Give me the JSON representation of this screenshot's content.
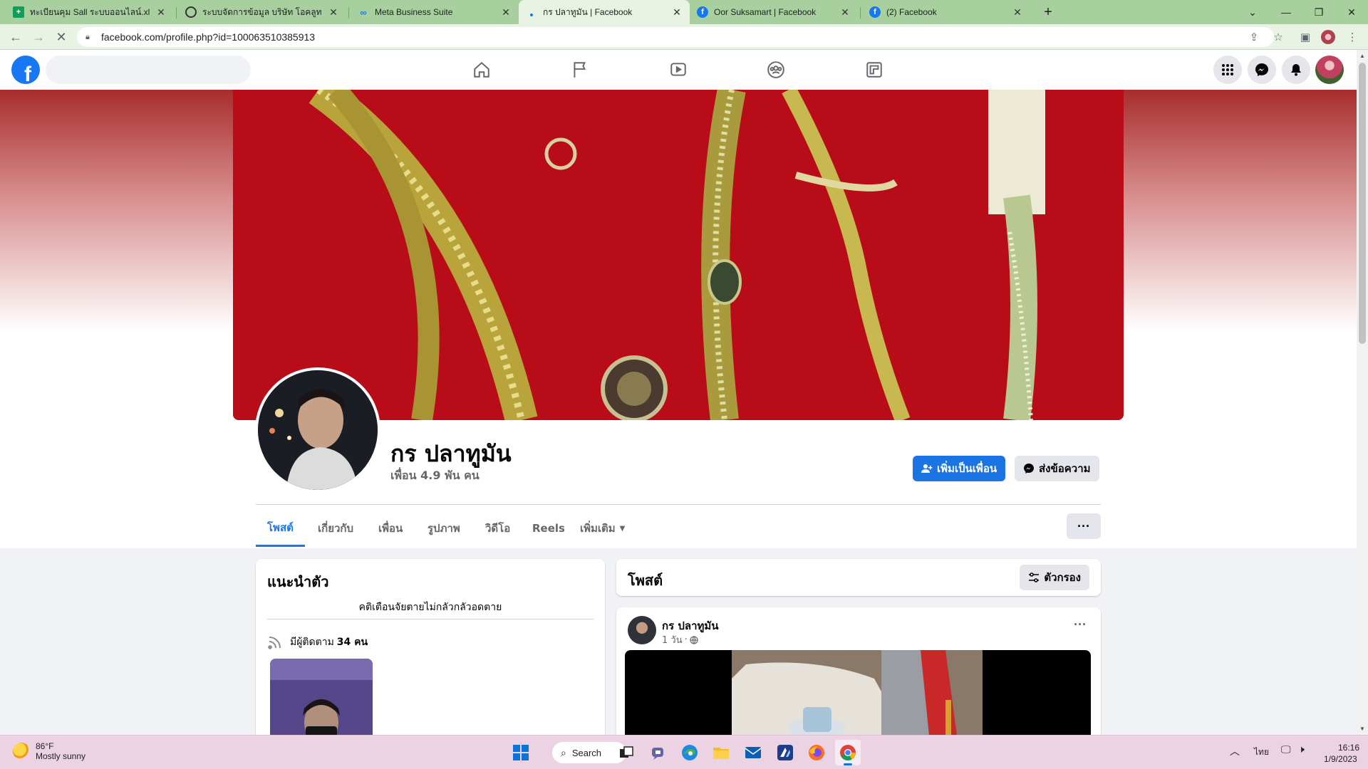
{
  "browser": {
    "tabs": [
      {
        "title": "ทะเบียนคุม Sall ระบบออนไลน์.xlsx - Goo",
        "icon": "google-sheets-icon"
      },
      {
        "title": "ระบบจัดการข้อมูล บริษัท โอคลูทเน็ต จำ",
        "icon": "globe-icon"
      },
      {
        "title": "Meta Business Suite",
        "icon": "meta-icon"
      },
      {
        "title": "กร ปลาทูมัน | Facebook",
        "icon": "loading-icon"
      },
      {
        "title": "Oor Suksamart | Facebook",
        "icon": "facebook-icon"
      },
      {
        "title": "(2) Facebook",
        "icon": "facebook-icon"
      }
    ],
    "new_tab": "+",
    "url": "facebook.com/profile.php?id=100063510385913"
  },
  "profile": {
    "name": "กร ปลาทูมัน",
    "friends": "เพื่อน 4.9 พัน คน",
    "add_friend_label": "เพิ่มเป็นเพื่อน",
    "message_label": "ส่งข้อความ",
    "tabs": [
      "โพสต์",
      "เกี่ยวกับ",
      "เพื่อน",
      "รูปภาพ",
      "วิดีโอ",
      "Reels",
      "เพิ่มเติม"
    ],
    "more_dots": "···"
  },
  "intro": {
    "title": "แนะนำตัว",
    "bio": "คติเตือนจัยตายไม่กลัวกลัวอดตาย",
    "followers_prefix": "มีผู้ติดตาม",
    "followers_count": "34 คน"
  },
  "posts": {
    "title": "โพสต์",
    "filter_label": "ตัวกรอง",
    "post": {
      "author": "กร ปลาทูมัน",
      "time": "1 วัน",
      "privacy": "public-globe-icon",
      "dots": "···"
    }
  },
  "taskbar": {
    "temp": "86°F",
    "weather": "Mostly sunny",
    "search_label": "Search",
    "lang": "ไทย",
    "time": "16:16",
    "date": "1/9/2023"
  },
  "colors": {
    "facebook_blue": "#1877f2",
    "tab_bar": "#a8cf9e",
    "cover_red": "#b90d18",
    "taskbar": "#ecd3e4"
  }
}
